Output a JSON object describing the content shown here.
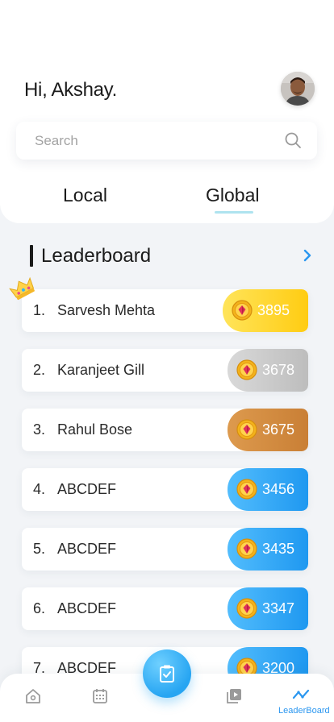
{
  "header": {
    "greeting": "Hi, Akshay.",
    "avatar_icon": "user-avatar"
  },
  "search": {
    "placeholder": "Search",
    "value": "",
    "icon": "search-icon"
  },
  "tabs": [
    {
      "label": "Local",
      "active": false
    },
    {
      "label": "Global",
      "active": true
    }
  ],
  "section": {
    "title": "Leaderboard",
    "more_icon": "chevron-right-icon"
  },
  "leaderboard": [
    {
      "rank": "1.",
      "name": "Sarvesh Mehta",
      "score": "3895",
      "tier": "gold"
    },
    {
      "rank": "2.",
      "name": "Karanjeet Gill",
      "score": "3678",
      "tier": "silver"
    },
    {
      "rank": "3.",
      "name": "Rahul Bose",
      "score": "3675",
      "tier": "bronze"
    },
    {
      "rank": "4.",
      "name": "ABCDEF",
      "score": "3456",
      "tier": "blue"
    },
    {
      "rank": "5.",
      "name": "ABCDEF",
      "score": "3435",
      "tier": "blue"
    },
    {
      "rank": "6.",
      "name": "ABCDEF",
      "score": "3347",
      "tier": "blue"
    },
    {
      "rank": "7.",
      "name": "ABCDEF",
      "score": "3200",
      "tier": "blue"
    }
  ],
  "colors": {
    "gold": "#ffd21f",
    "silver": "#c9c9c9",
    "bronze": "#d48b3f",
    "blue": "#2fa6f6",
    "accent": "#2b97f0"
  },
  "bottom_nav": {
    "items": [
      {
        "icon": "home-icon"
      },
      {
        "icon": "calendar-icon"
      },
      {
        "icon": "clipboard-check-icon"
      },
      {
        "icon": "media-playlist-icon"
      },
      {
        "icon": "leaderboard-icon",
        "label": "LeaderBoard",
        "active": true
      }
    ]
  }
}
